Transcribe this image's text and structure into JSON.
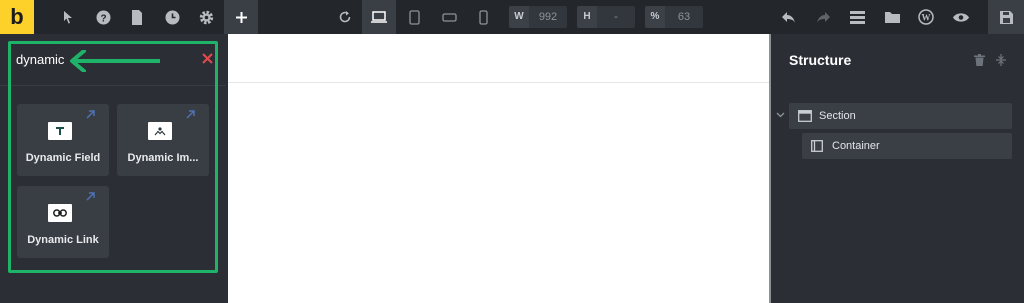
{
  "app": {
    "logo_letter": "b",
    "accent_color": "#fdd02a",
    "highlight_color": "#1fb36a"
  },
  "toolbar": {
    "left_icons": [
      "pointer-icon",
      "help-icon",
      "pages-icon",
      "history-icon",
      "settings-icon",
      "add-icon"
    ],
    "device_icons": [
      "undo-preview-icon",
      "desktop-icon",
      "tablet-portrait-icon",
      "tablet-landscape-icon",
      "mobile-icon"
    ],
    "width_label": "W",
    "width_value": "992",
    "height_label": "H",
    "height_value": "-",
    "zoom_label": "%",
    "zoom_value": "63",
    "right_icons": [
      "undo-icon",
      "redo-icon",
      "templates-icon",
      "folder-icon",
      "wordpress-icon",
      "preview-icon",
      "save-icon"
    ]
  },
  "elements_panel": {
    "search_value": "dynamic",
    "results": [
      {
        "label": "Dynamic Field",
        "icon": "text-field-icon"
      },
      {
        "label": "Dynamic Im...",
        "icon": "image-icon"
      },
      {
        "label": "Dynamic Link",
        "icon": "link-icon"
      }
    ]
  },
  "structure_panel": {
    "title": "Structure",
    "tree": [
      {
        "label": "Section",
        "icon": "section-icon",
        "level": 0
      },
      {
        "label": "Container",
        "icon": "container-icon",
        "level": 1
      }
    ]
  }
}
